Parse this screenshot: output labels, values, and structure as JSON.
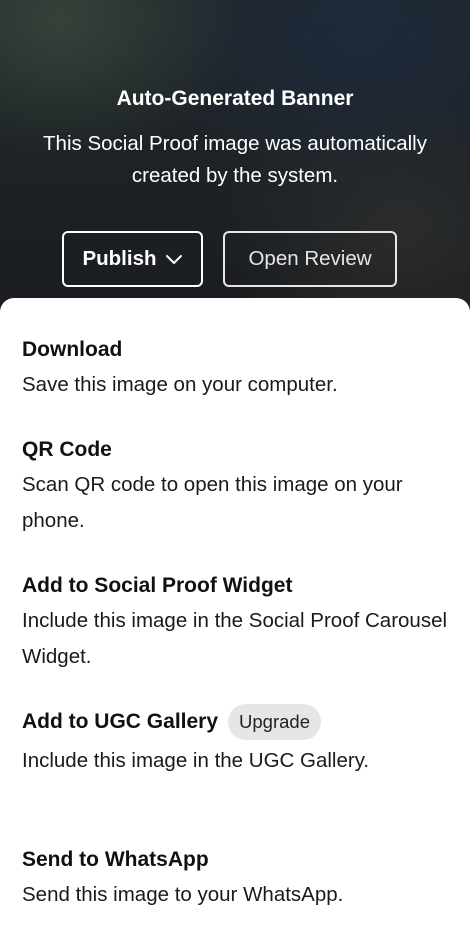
{
  "hero": {
    "title": "Auto-Generated Banner",
    "description": "This Social Proof image was automatically created by the system.",
    "publish_label": "Publish",
    "open_review_label": "Open Review"
  },
  "menu": {
    "items": [
      {
        "title": "Download",
        "description": "Save this image on your computer."
      },
      {
        "title": "QR Code",
        "description": "Scan QR code to open this image on your phone."
      },
      {
        "title": "Add to Social Proof Widget",
        "description": "Include this image in the Social Proof Carousel Widget."
      },
      {
        "title": "Add to UGC Gallery",
        "badge": "Upgrade",
        "description": "Include this image in the UGC Gallery."
      },
      {
        "title": "Send to WhatsApp",
        "description": "Send this image to your WhatsApp."
      }
    ]
  },
  "icons": {
    "publish_dropdown": "chevron-down-icon"
  }
}
